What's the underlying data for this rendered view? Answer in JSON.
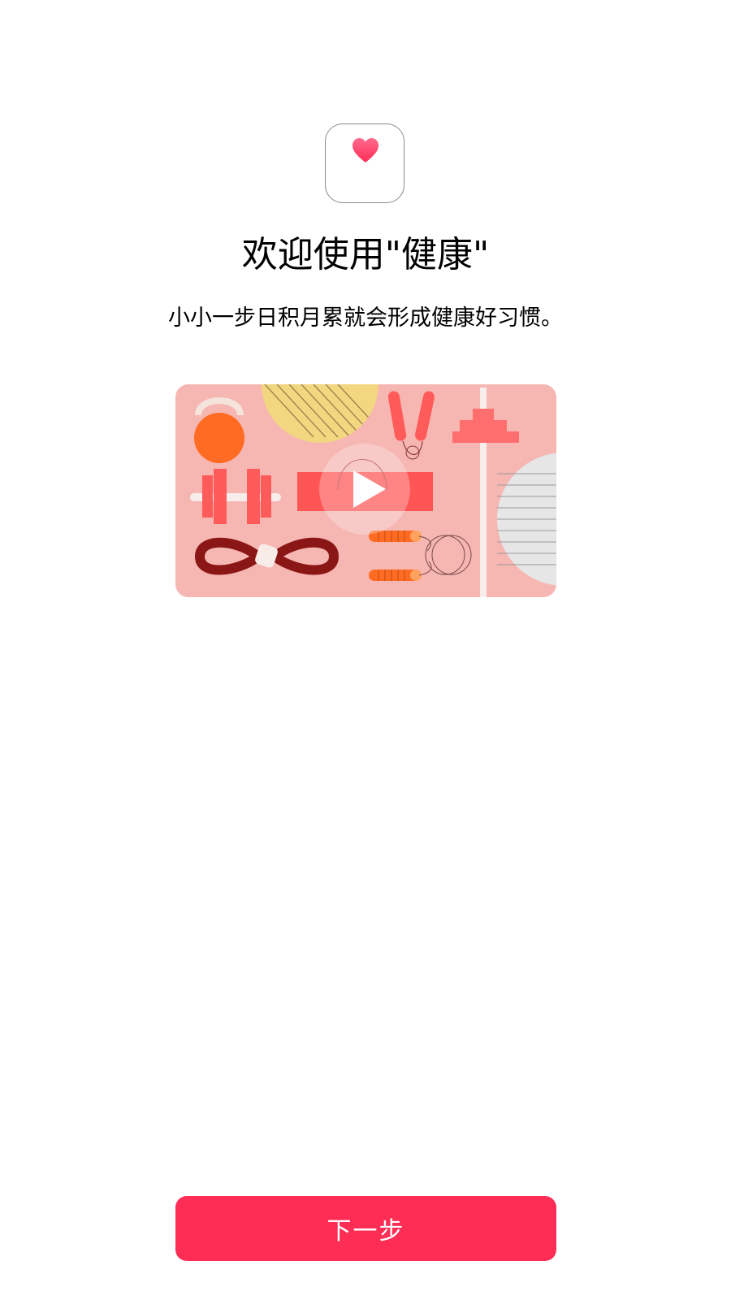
{
  "app_icon": {
    "icon": "heart-icon",
    "accent_top": "#ff5f86",
    "accent_bottom": "#ff2d55"
  },
  "welcome": {
    "title": "欢迎使用\"健康\"",
    "subtitle": "小小一步日积月累就会形成健康好习惯。"
  },
  "video": {
    "play_icon": "play-icon",
    "background_color": "#f6b6b2"
  },
  "footer": {
    "next_label": "下一步",
    "button_color": "#fe2d55"
  }
}
